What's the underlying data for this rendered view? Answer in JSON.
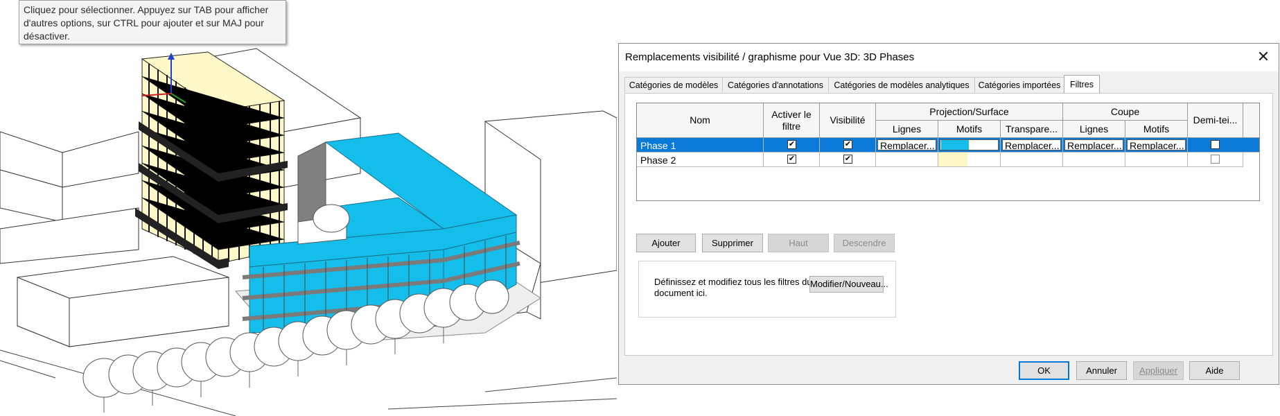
{
  "tooltip": {
    "text": "Cliquez pour sélectionner. Appuyez sur TAB pour afficher d'autres options, sur CTRL pour ajouter et sur MAJ pour désactiver."
  },
  "dialog": {
    "title": "Remplacements visibilité / graphisme pour Vue 3D: 3D Phases",
    "close_icon": "close-icon",
    "tabs": [
      {
        "label": "Catégories de modèles"
      },
      {
        "label": "Catégories d'annotations"
      },
      {
        "label": "Catégories de modèles analytiques"
      },
      {
        "label": "Catégories importées"
      },
      {
        "label": "Filtres"
      }
    ],
    "active_tab": "Filtres",
    "grid": {
      "headers": {
        "nom": "Nom",
        "activer": "Activer le filtre",
        "visibilite": "Visibilité",
        "projection": "Projection/Surface",
        "coupe": "Coupe",
        "demi": "Demi-tei...",
        "proj_lignes": "Lignes",
        "proj_motifs": "Motifs",
        "proj_transparence": "Transpare...",
        "coupe_lignes": "Lignes",
        "coupe_motifs": "Motifs"
      },
      "rows": [
        {
          "nom": "Phase 1",
          "activer": true,
          "visibilite": true,
          "proj_lignes": "Remplacer...",
          "proj_motifs_color": "#14bdea",
          "proj_transparence": "Remplacer...",
          "coupe_lignes": "Remplacer...",
          "coupe_motifs": "Remplacer...",
          "demi": false,
          "selected": true
        },
        {
          "nom": "Phase 2",
          "activer": true,
          "visibilite": true,
          "proj_lignes": "",
          "proj_motifs_color": "#fef7c8",
          "proj_transparence": "",
          "coupe_lignes": "",
          "coupe_motifs": "",
          "demi": false,
          "selected": false
        }
      ]
    },
    "buttons": {
      "ajouter": "Ajouter",
      "supprimer": "Supprimer",
      "haut": "Haut",
      "descendre": "Descendre",
      "modifier": "Modifier/Nouveau...",
      "ok": "OK",
      "annuler": "Annuler",
      "appliquer": "Appliquer",
      "aide": "Aide"
    },
    "info_text": "Définissez et modifiez tous les filtres du document ici."
  },
  "colors": {
    "phase1": "#14bdea",
    "phase2": "#fef7c8",
    "selection": "#0b79d8"
  }
}
